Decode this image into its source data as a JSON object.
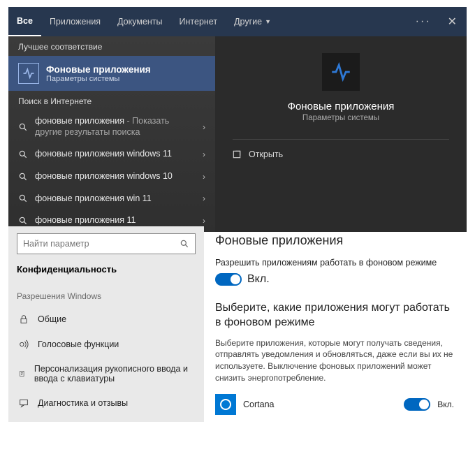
{
  "search": {
    "tabs": [
      "Все",
      "Приложения",
      "Документы",
      "Интернет",
      "Другие"
    ],
    "best_match_header": "Лучшее соответствие",
    "best": {
      "title": "Фоновые приложения",
      "sub": "Параметры системы"
    },
    "web_header": "Поиск в Интернете",
    "web_results": [
      {
        "main": "фоновые приложения",
        "suffix": " - Показать другие результаты поиска"
      },
      {
        "main": "фоновые приложения windows 11",
        "suffix": ""
      },
      {
        "main": "фоновые приложения windows 10",
        "suffix": ""
      },
      {
        "main": "фоновые приложения win 11",
        "suffix": ""
      },
      {
        "main": "фоновые приложения 11",
        "suffix": ""
      }
    ],
    "preview": {
      "title": "Фоновые приложения",
      "sub": "Параметры системы",
      "open": "Открыть"
    }
  },
  "settings": {
    "search_placeholder": "Найти параметр",
    "category": "Конфиденциальность",
    "section_header": "Разрешения Windows",
    "items": [
      "Общие",
      "Голосовые функции",
      "Персонализация рукописного ввода и ввода с клавиатуры",
      "Диагностика и отзывы"
    ],
    "page_title": "Фоновые приложения",
    "allow_label": "Разрешить приложениям работать в фоновом режиме",
    "on_label": "Вкл.",
    "choose_heading": "Выберите, какие приложения могут работать в фоновом режиме",
    "choose_desc": "Выберите приложения, которые могут получать сведения, отправлять уведомления и обновляться, даже если вы их не используете. Выключение фоновых приложений может снизить энергопотребление.",
    "apps": [
      {
        "name": "Cortana",
        "state": "Вкл."
      }
    ]
  }
}
